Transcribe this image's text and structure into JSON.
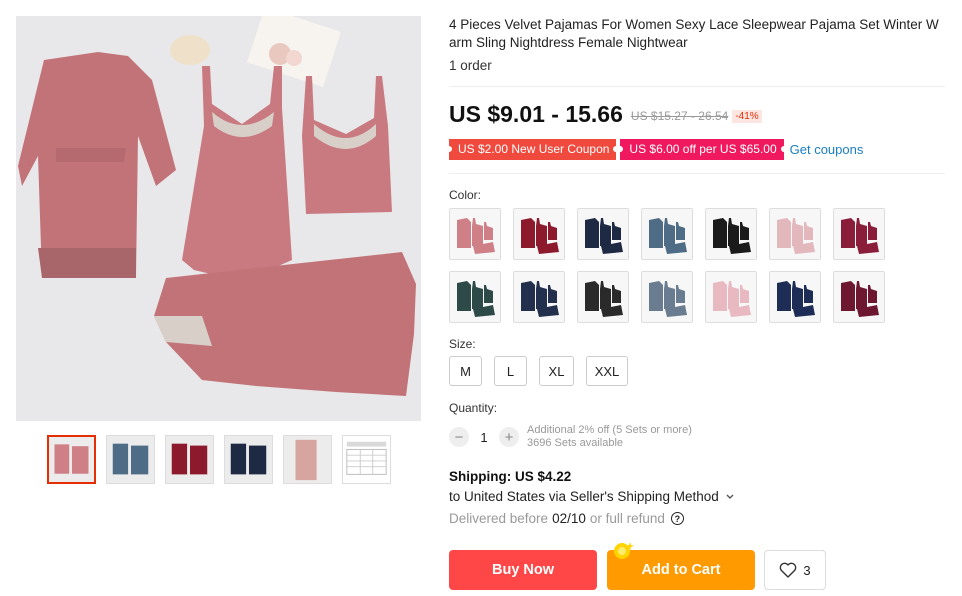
{
  "product": {
    "title": "4 Pieces Velvet Pajamas For Women Sexy Lace Sleepwear Pajama Set Winter Warm Sling Nightdress Female Nightwear",
    "orders": "1 order",
    "price": "US $9.01 - 15.66",
    "original_price": "US $15.27 - 26.54",
    "discount": "-41%"
  },
  "coupons": {
    "items": [
      "US $2.00 New User Coupon",
      "US $6.00 off per US $65.00"
    ],
    "get_coupons_label": "Get coupons"
  },
  "color": {
    "label": "Color:",
    "row1": [
      "#cf7f86",
      "#8c1a2c",
      "#1e2a44",
      "#4f6c86",
      "#1b1b1b",
      "#e3b8bd",
      "#8a1d3a"
    ],
    "row2": [
      "#2e4a48",
      "#23304d",
      "#2a2a2a",
      "#6a7c90",
      "#e8b9c0",
      "#1d2d55",
      "#6d1730"
    ]
  },
  "size": {
    "label": "Size:",
    "options": [
      "M",
      "L",
      "XL",
      "XXL"
    ]
  },
  "quantity": {
    "label": "Quantity:",
    "value": "1",
    "minus": "−",
    "plus": "+",
    "note_line1": "Additional 2% off (5 Sets or more)",
    "note_line2": "3696 Sets available"
  },
  "shipping": {
    "title": "Shipping: US $4.22",
    "destination": "to United States via Seller's Shipping Method",
    "delivered_prefix": "Delivered before",
    "delivered_date": "02/10",
    "delivered_suffix": "or full refund",
    "help_glyph": "?"
  },
  "actions": {
    "buy_now": "Buy Now",
    "add_to_cart": "Add to Cart",
    "wishlist_count": "3"
  },
  "gallery": {
    "thumb_colors": [
      "#cf7f86",
      "#4f6c86",
      "#8c1a2c",
      "#1e2a44",
      "#d7a59f",
      "#ffffff"
    ],
    "main_color": "#c57a7f"
  },
  "icons": {
    "heart": "heart-icon",
    "chevron": "chevron-down-icon",
    "help": "help-icon",
    "sparkle": "sparkle-icon"
  }
}
